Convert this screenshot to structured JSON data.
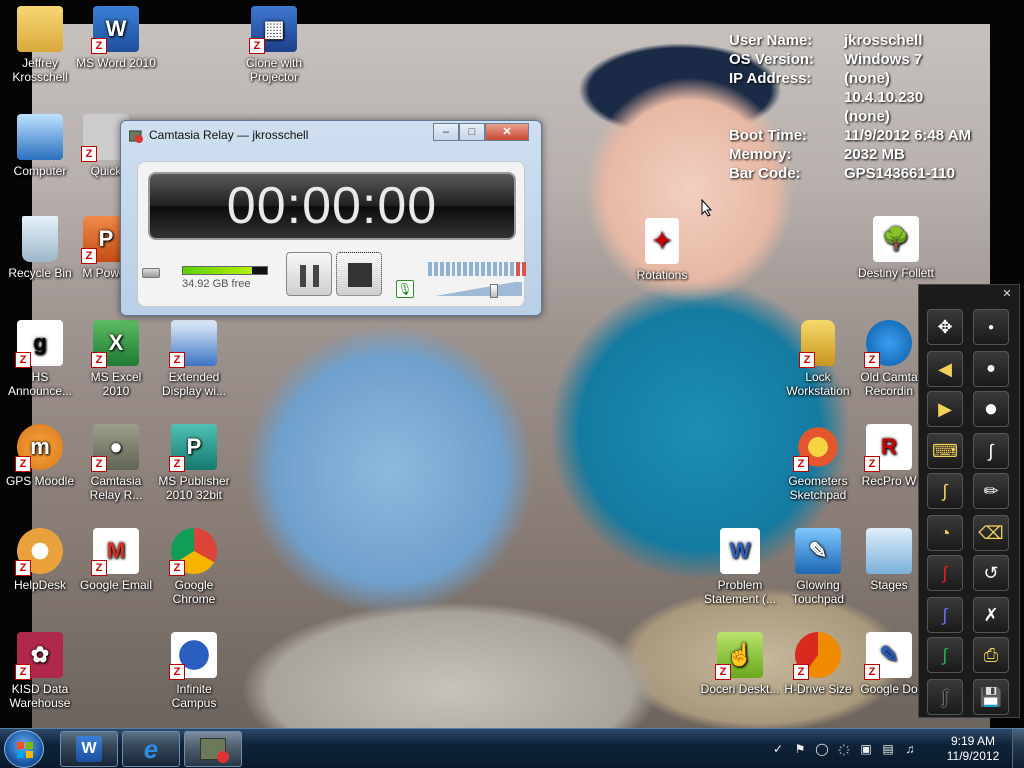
{
  "desktop": {
    "icons": {
      "jeffrey": "Jeffrey Krosschell",
      "msword": "MS Word 2010",
      "clone": "Clone with Projector",
      "computer": "Computer",
      "quick": "Quick",
      "recycle": "Recycle Bin",
      "mspower": "M Power",
      "rotations": "Rotations",
      "destiny": "Destiny Follett",
      "hs": "HS Announce...",
      "msexcel": "MS Excel 2010",
      "extended": "Extended Display wi...",
      "lock": "Lock Workstation",
      "oldcam": "Old Camta Recordin",
      "moodle": "GPS Moodle",
      "camtasia_relay": "Camtasia Relay R...",
      "publisher": "MS Publisher 2010 32bit",
      "geometers": "Geometers Sketchpad",
      "recpro": "RecPro W",
      "helpdesk": "HelpDesk",
      "gmail": "Google Email",
      "chrome": "Google Chrome",
      "problem": "Problem Statement (...",
      "glowing": "Glowing Touchpad",
      "stages": "Stages",
      "kisd": "KISD Data Warehouse",
      "infinite": "Infinite Campus",
      "doceri": "Doceri Deskt...",
      "hdrive": "H-Drive Size",
      "gdocs": "Google Do"
    }
  },
  "sysinfo": [
    {
      "k": "User Name:",
      "v": "jkrosschell"
    },
    {
      "k": "OS Version:",
      "v": "Windows 7"
    },
    {
      "k": "IP Address:",
      "v": "(none)"
    },
    {
      "k": "",
      "v": "10.4.10.230"
    },
    {
      "k": "",
      "v": "(none)"
    },
    {
      "k": "Boot Time:",
      "v": "11/9/2012 6:48 AM"
    },
    {
      "k": "Memory:",
      "v": "2032 MB"
    },
    {
      "k": "Bar Code:",
      "v": "GPS143661-110"
    }
  ],
  "camtasia": {
    "title": "Camtasia Relay — jkrosschell",
    "timer": "00:00:00",
    "free_space": "34.92 GB free",
    "disk_usage_fraction": 0.82,
    "minimize": "–",
    "maximize": "□",
    "close": "✕"
  },
  "pen_toolbar": {
    "close": "✕"
  },
  "taskbar": {
    "time": "9:19 AM",
    "date": "11/9/2012"
  }
}
